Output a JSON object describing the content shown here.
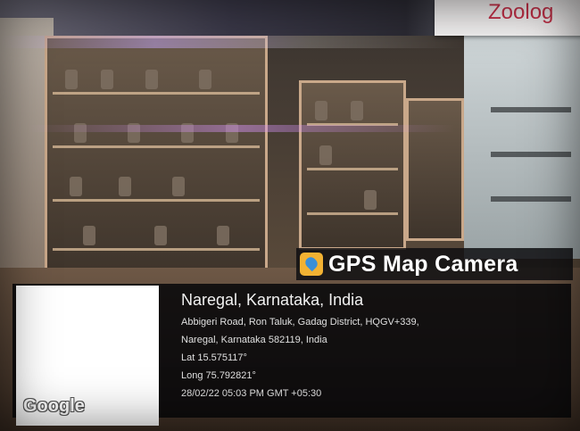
{
  "badge": {
    "text": "Zoolog"
  },
  "gps": {
    "app_title": "GPS Map Camera",
    "icon": "map-pin-icon",
    "place": "Naregal, Karnataka, India",
    "address_line_1": "Abbigeri Road, Ron Taluk, Gadag District, HQGV+339,",
    "address_line_2": "Naregal, Karnataka 582119, India",
    "lat": "Lat 15.575117°",
    "long": "Long 75.792821°",
    "timestamp": "28/02/22 05:03 PM GMT +05:30",
    "map_label": "Google"
  }
}
